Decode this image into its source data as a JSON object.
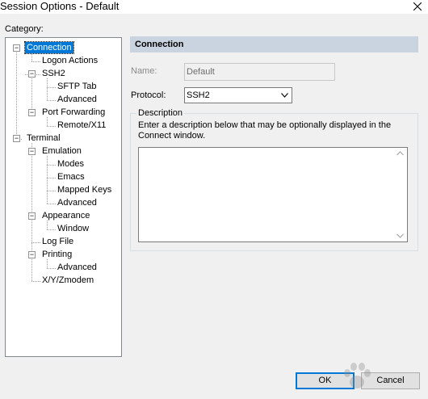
{
  "window": {
    "title": "Session Options - Default",
    "close_icon": "close-icon"
  },
  "category": {
    "label": "Category:",
    "tree": [
      {
        "label": "Connection",
        "expander": "−",
        "selected": true
      },
      {
        "label": "Logon Actions"
      },
      {
        "label": "SSH2",
        "expander": "−"
      },
      {
        "label": "SFTP Tab"
      },
      {
        "label": "Advanced"
      },
      {
        "label": "Port Forwarding",
        "expander": "−"
      },
      {
        "label": "Remote/X11"
      },
      {
        "label": "Terminal",
        "expander": "−"
      },
      {
        "label": "Emulation",
        "expander": "−"
      },
      {
        "label": "Modes"
      },
      {
        "label": "Emacs"
      },
      {
        "label": "Mapped Keys"
      },
      {
        "label": "Advanced"
      },
      {
        "label": "Appearance",
        "expander": "−"
      },
      {
        "label": "Window"
      },
      {
        "label": "Log File"
      },
      {
        "label": "Printing",
        "expander": "−"
      },
      {
        "label": "Advanced"
      },
      {
        "label": "X/Y/Zmodem"
      }
    ]
  },
  "panel": {
    "header": "Connection",
    "name": {
      "label": "Name:",
      "value": "Default"
    },
    "protocol": {
      "label": "Protocol:",
      "value": "SSH2"
    },
    "description": {
      "legend": "Description",
      "help": "Enter a description below that may be optionally displayed in the Connect window.",
      "value": ""
    }
  },
  "buttons": {
    "ok": "OK",
    "cancel": "Cancel"
  },
  "colors": {
    "selection": "#0078d7",
    "header_band": "#c9d4e0",
    "window_bg": "#f0f0f0"
  }
}
